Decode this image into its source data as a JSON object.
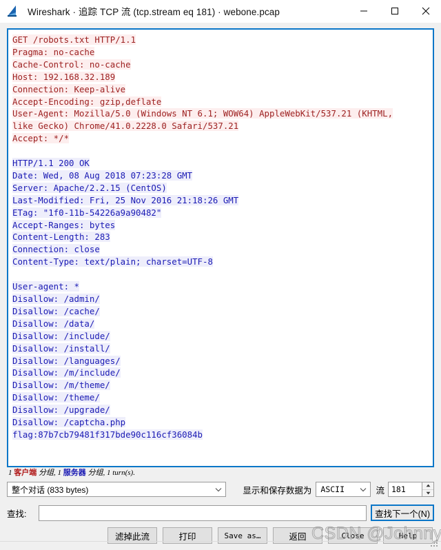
{
  "window": {
    "title": "Wireshark · 追踪 TCP 流 (tcp.stream eq 181) · webone.pcap",
    "icon": "wireshark-fin-icon",
    "minimize": "—",
    "maximize": "□",
    "close": "✕"
  },
  "stream": {
    "request_lines": [
      "GET /robots.txt HTTP/1.1",
      "Pragma: no-cache",
      "Cache-Control: no-cache",
      "Host: 192.168.32.189",
      "Connection: Keep-alive",
      "Accept-Encoding: gzip,deflate",
      "User-Agent: Mozilla/5.0 (Windows NT 6.1; WOW64) AppleWebKit/537.21 (KHTML,",
      "like Gecko) Chrome/41.0.2228.0 Safari/537.21",
      "Accept: */*"
    ],
    "response_lines": [
      "HTTP/1.1 200 OK",
      "Date: Wed, 08 Aug 2018 07:23:28 GMT",
      "Server: Apache/2.2.15 (CentOS)",
      "Last-Modified: Fri, 25 Nov 2016 21:18:26 GMT",
      "ETag: \"1f0-11b-54226a9a90482\"",
      "Accept-Ranges: bytes",
      "Content-Length: 283",
      "Connection: close",
      "Content-Type: text/plain; charset=UTF-8"
    ],
    "body_lines": [
      "User-agent: *",
      "Disallow: /admin/",
      "Disallow: /cache/",
      "Disallow: /data/",
      "Disallow: /include/",
      "Disallow: /install/",
      "Disallow: /languages/",
      "Disallow: /m/include/",
      "Disallow: /m/theme/",
      "Disallow: /theme/",
      "Disallow: /upgrade/",
      "Disallow: /captcha.php",
      "flag:87b7cb79481f317bde90c116cf36084b"
    ],
    "colors": {
      "request_text": "#9c1f1f",
      "request_bg": "#fdeeee",
      "response_text": "#1a1ab4",
      "response_bg": "#eeeefb",
      "pane_border": "#0a76c8"
    }
  },
  "status": {
    "prefix_count": "1 ",
    "client_word": "客户端",
    "middle": " 分组, 1 ",
    "server_word": "服务器",
    "suffix": " 分组, 1 turn(s)."
  },
  "controls": {
    "conversation_value": "整个对话 (833 bytes)",
    "show_save_label": "显示和保存数据为",
    "encoding_value": "ASCII",
    "stream_label": "流",
    "stream_number": "181"
  },
  "find": {
    "label": "查找:",
    "value": "",
    "placeholder": "",
    "next_button": "查找下一个(N)"
  },
  "buttons": [
    {
      "label": "滤掉此流",
      "name": "filter-out-this-stream-button",
      "mono": false
    },
    {
      "label": "打印",
      "name": "print-button",
      "mono": false
    },
    {
      "label": "Save as…",
      "name": "save-as-button",
      "mono": true
    },
    {
      "label": "返回",
      "name": "back-button",
      "mono": false
    },
    {
      "label": "Close",
      "name": "close-button",
      "mono": true
    },
    {
      "label": "Help",
      "name": "help-button",
      "mono": true
    }
  ],
  "watermark": {
    "text": "CSDN @Johnny.G"
  }
}
